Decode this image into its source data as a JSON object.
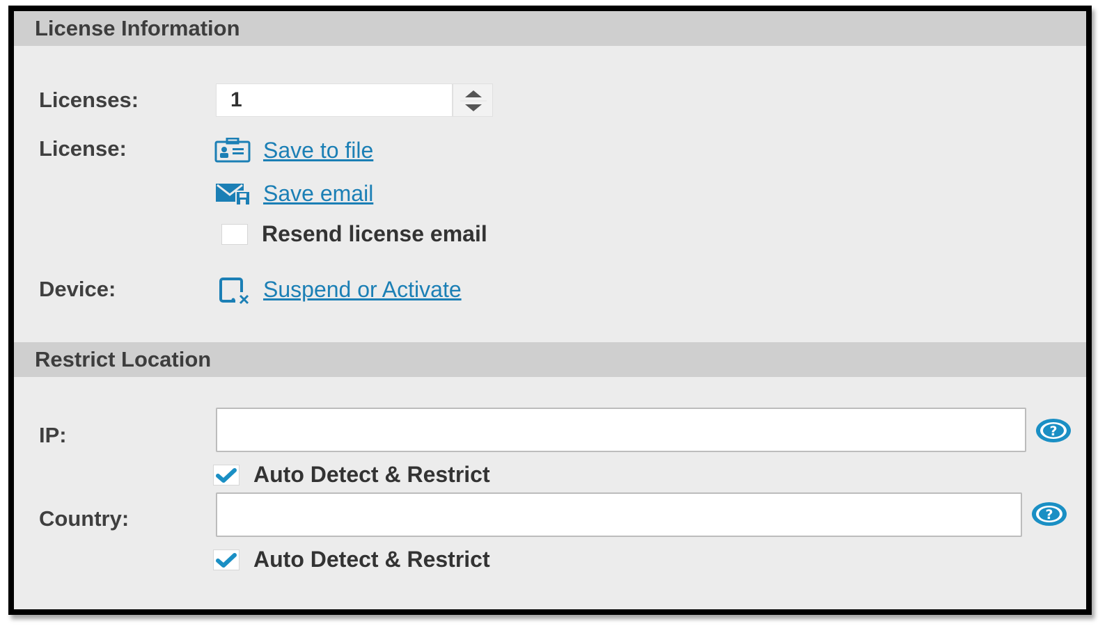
{
  "license_section": {
    "title": "License Information",
    "licenses_label": "Licenses:",
    "licenses_value": "1",
    "license_label": "License:",
    "save_to_file": "Save to file",
    "save_email": "Save email",
    "resend_label": "Resend license email",
    "resend_checked": false,
    "device_label": "Device:",
    "suspend_activate": "Suspend or Activate"
  },
  "restrict_section": {
    "title": "Restrict Location",
    "ip_label": "IP:",
    "ip_value": "",
    "ip_auto_label": "Auto Detect & Restrict",
    "ip_auto_checked": true,
    "country_label": "Country:",
    "country_value": "",
    "country_auto_label": "Auto Detect & Restrict",
    "country_auto_checked": true
  },
  "icons": {
    "save_file": "save-file-icon",
    "save_email": "save-email-icon",
    "device": "device-suspend-icon",
    "help": "help-icon",
    "check": "checkmark-icon"
  },
  "colors": {
    "link": "#1b7fb5",
    "header_bg": "#cfcfcf",
    "panel_bg": "#ececec",
    "check": "#1a8fc4"
  }
}
